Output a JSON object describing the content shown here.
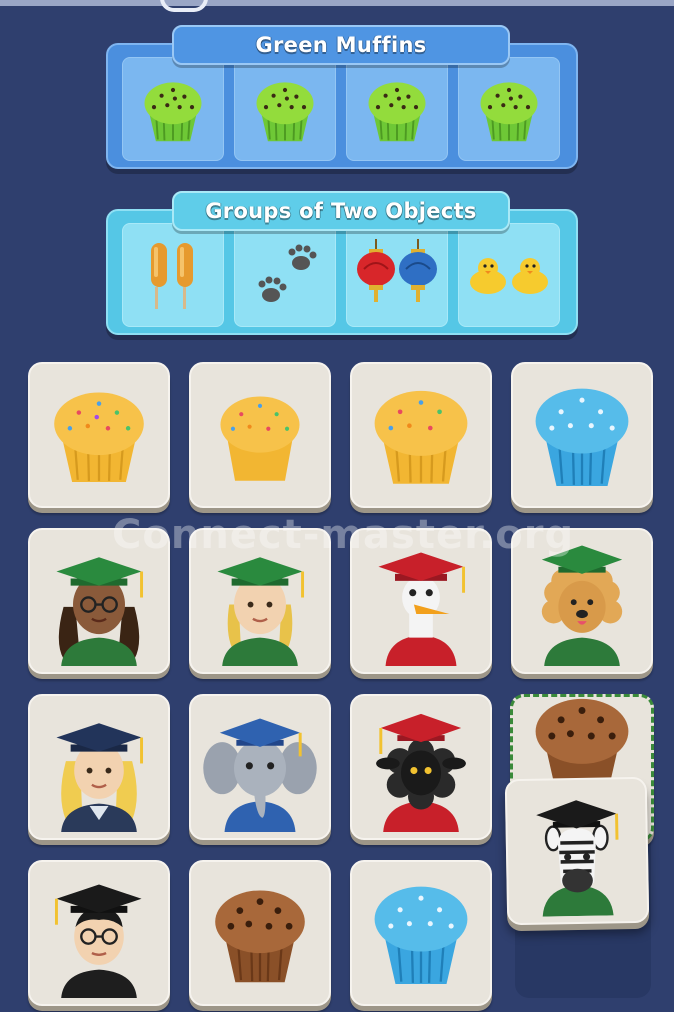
{
  "groups": [
    {
      "title": "Green Muffins",
      "items": [
        "green-muffin-icon",
        "green-muffin-icon",
        "green-muffin-icon",
        "green-muffin-icon"
      ]
    },
    {
      "title": "Groups of Two Objects",
      "items": [
        "corn-dogs-icon",
        "paw-prints-icon",
        "lanterns-icon",
        "ducklings-icon"
      ]
    }
  ],
  "board": {
    "tiles": [
      "yellow-muffin-icon",
      "yellow-muffin-icon",
      "yellow-muffin-icon",
      "blue-muffin-icon",
      "graduate-woman-glasses-icon",
      "graduate-blonde-braids-icon",
      "graduate-goose-icon",
      "graduate-dog-icon",
      "graduate-blonde-woman-icon",
      "graduate-elephant-icon",
      "graduate-black-sheep-icon",
      "chocolate-muffin-icon",
      "graduate-man-glasses-icon",
      "chocolate-muffin-icon",
      "blue-muffin-icon",
      "graduate-zebra-icon"
    ]
  },
  "watermark": "Connect-master.org",
  "colors": {
    "background": "#2f3f6e",
    "group_blue": "#4b8fde",
    "group_cyan": "#55c7e6",
    "tile": "#e8e4dc",
    "selection": "#3a8a3a"
  }
}
